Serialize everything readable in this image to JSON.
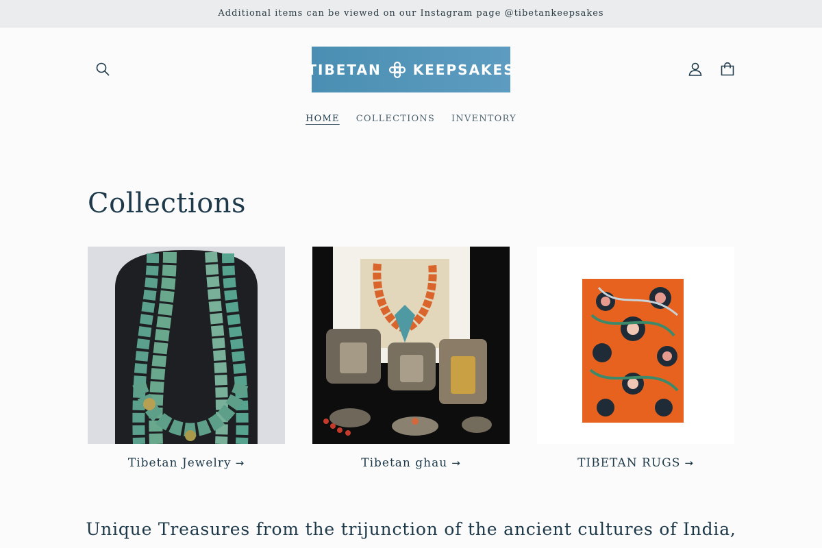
{
  "announcement": {
    "text": "Additional items can be viewed on our Instagram page @tibetankeepsakes"
  },
  "header": {
    "logo_text_left": "TIBETAN",
    "logo_text_right": "KEEPSAKES",
    "icons": {
      "search": "search-icon",
      "account": "account-icon",
      "cart": "cart-icon"
    }
  },
  "nav": {
    "items": [
      {
        "label": "HOME",
        "active": true
      },
      {
        "label": "COLLECTIONS",
        "active": false
      },
      {
        "label": "INVENTORY",
        "active": false
      }
    ]
  },
  "main": {
    "title": "Collections",
    "collections": [
      {
        "label": "Tibetan Jewelry",
        "arrow": "→"
      },
      {
        "label": "Tibetan ghau",
        "arrow": "→"
      },
      {
        "label": "TIBETAN RUGS",
        "arrow": "→"
      }
    ],
    "tagline": "Unique Treasures from the trijunction of the ancient cultures of India,"
  },
  "colors": {
    "text": "#1e3a4a",
    "logo_bg": "#4a8fb3",
    "announcement_bg": "#ebeced"
  }
}
